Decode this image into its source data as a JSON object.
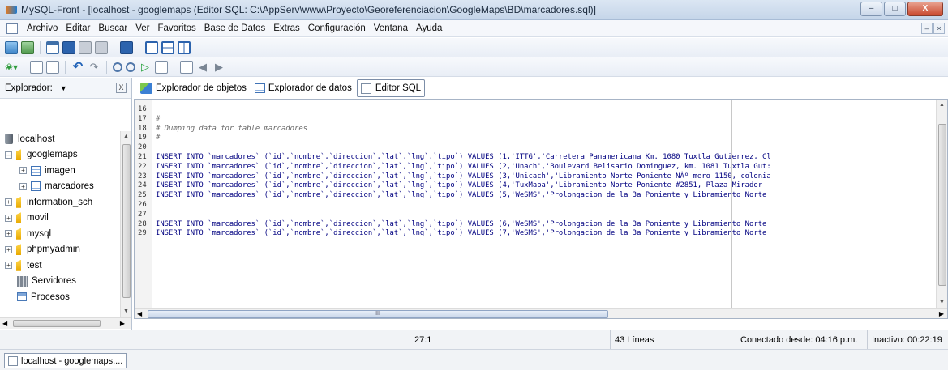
{
  "window": {
    "title": "MySQL-Front - [localhost - googlemaps  (Editor SQL: C:\\AppServ\\www\\Proyecto\\Georeferenciacion\\GoogleMaps\\BD\\marcadores.sql)]",
    "minimize": "–",
    "maximize": "□",
    "close": "X"
  },
  "menu": {
    "items": [
      "Archivo",
      "Editar",
      "Buscar",
      "Ver",
      "Favoritos",
      "Base de Datos",
      "Extras",
      "Configuración",
      "Ventana",
      "Ayuda"
    ],
    "mdi_minimize": "–",
    "mdi_restore": "×"
  },
  "explorer": {
    "label": "Explorador:",
    "dropdown_arrow": "▼",
    "close": "X",
    "tree": [
      {
        "label": "localhost",
        "expander": ""
      },
      {
        "label": "googlemaps",
        "expander": "–"
      },
      {
        "label": "imagen",
        "expander": "+"
      },
      {
        "label": "marcadores",
        "expander": "+"
      },
      {
        "label": "information_sch",
        "expander": "+"
      },
      {
        "label": "movil",
        "expander": "+"
      },
      {
        "label": "mysql",
        "expander": "+"
      },
      {
        "label": "phpmyadmin",
        "expander": "+"
      },
      {
        "label": "test",
        "expander": "+"
      },
      {
        "label": "Servidores",
        "expander": ""
      },
      {
        "label": "Procesos",
        "expander": ""
      }
    ]
  },
  "tabs": [
    {
      "label": "Explorador de objetos",
      "icon": "objects-icon"
    },
    {
      "label": "Explorador de datos",
      "icon": "data-grid-icon"
    },
    {
      "label": "Editor SQL",
      "icon": "sql-editor-icon",
      "active": true
    }
  ],
  "editor": {
    "lines": [
      {
        "n": "16",
        "code": ""
      },
      {
        "n": "17",
        "code": "#",
        "comment": true
      },
      {
        "n": "18",
        "code": "# Dumping data for table marcadores",
        "comment": true
      },
      {
        "n": "19",
        "code": "#",
        "comment": true
      },
      {
        "n": "20",
        "code": ""
      },
      {
        "n": "21",
        "code": "INSERT INTO `marcadores` (`id`,`nombre`,`direccion`,`lat`,`lng`,`tipo`) VALUES (1,'ITTG','Carretera Panamericana Km. 1080 Tuxtla Gutierrez, Cl"
      },
      {
        "n": "22",
        "code": "INSERT INTO `marcadores` (`id`,`nombre`,`direccion`,`lat`,`lng`,`tipo`) VALUES (2,'Unach','Boulevard Belisario Dominguez, km. 1081 Tuxtla Gut:"
      },
      {
        "n": "23",
        "code": "INSERT INTO `marcadores` (`id`,`nombre`,`direccion`,`lat`,`lng`,`tipo`) VALUES (3,'Unicach','Libramiento Norte Poniente NÂº mero 1150, colonia"
      },
      {
        "n": "24",
        "code": "INSERT INTO `marcadores` (`id`,`nombre`,`direccion`,`lat`,`lng`,`tipo`) VALUES (4,'TuxMapa','Libramiento Norte Poniente #2851, Plaza Mirador"
      },
      {
        "n": "25",
        "code": "INSERT INTO `marcadores` (`id`,`nombre`,`direccion`,`lat`,`lng`,`tipo`) VALUES (5,'WeSMS','Prolongacion de la 3a Poniente y Libramiento Norte"
      },
      {
        "n": "26",
        "code": ""
      },
      {
        "n": "27",
        "code": ""
      },
      {
        "n": "28",
        "code": "INSERT INTO `marcadores` (`id`,`nombre`,`direccion`,`lat`,`lng`,`tipo`) VALUES (6,'WeSMS','Prolongacion de la 3a Poniente y Libramiento Norte"
      },
      {
        "n": "29",
        "code": "INSERT INTO `marcadores` (`id`,`nombre`,`direccion`,`lat`,`lng`,`tipo`) VALUES (7,'WeSMS','Prolongacion de la 3a Poniente y Libramiento Norte"
      }
    ],
    "hscroll_grip": "III"
  },
  "status": {
    "cursor": "27:1",
    "lines": "43 Líneas",
    "connected": "Conectado desde: 04:16 p.m.",
    "inactive": "Inactivo: 00:22:19"
  },
  "taskbar": {
    "tab_label": "localhost - googlemaps...."
  },
  "colors": {
    "code_text": "#000080",
    "comment": "#666666",
    "folder": "#e8a800"
  }
}
